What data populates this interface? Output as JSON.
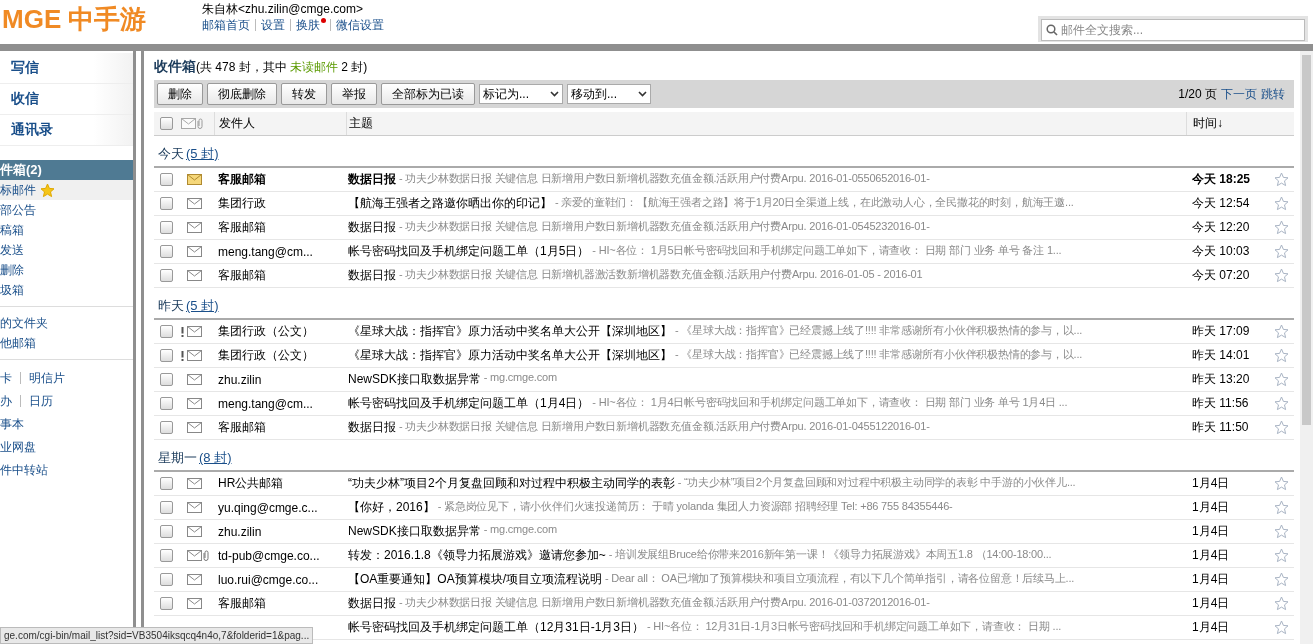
{
  "header": {
    "logo": "MGE 中手游",
    "user": "朱自林<zhu.zilin@cmge.com>",
    "links": [
      {
        "label": "邮箱首页"
      },
      {
        "label": "设置"
      },
      {
        "label": "换肤",
        "badge": true
      },
      {
        "label": "微信设置"
      }
    ],
    "search": {
      "placeholder": "邮件全文搜索..."
    }
  },
  "sidebar": {
    "actions": [
      {
        "label": "写信"
      },
      {
        "label": "收信"
      },
      {
        "label": "通讯录"
      }
    ],
    "folders": [
      {
        "label": "件箱(2)",
        "selected": true,
        "starred": false
      },
      {
        "label": "标邮件",
        "selected": false,
        "starred": true
      },
      {
        "label": "部公告",
        "selected": false,
        "starred": false
      },
      {
        "label": "稿箱",
        "selected": false,
        "starred": false
      },
      {
        "label": "发送",
        "selected": false,
        "starred": false
      },
      {
        "label": "删除",
        "selected": false,
        "starred": false
      },
      {
        "label": "圾箱",
        "selected": false,
        "starred": false
      }
    ],
    "my_folders": [
      {
        "label": "的文件夹"
      },
      {
        "label": "他邮箱"
      }
    ],
    "tools": [
      [
        "卡",
        "明信片"
      ],
      [
        "办",
        "日历"
      ],
      [
        "事本"
      ],
      [
        "业网盘"
      ],
      [
        "件中转站"
      ]
    ]
  },
  "mailbox": {
    "title": "收件箱",
    "summary_pre": "(共 478 封，其中 ",
    "unread_link": "未读邮件",
    "summary_post": " 2 封)",
    "select_all_checked": false,
    "buttons": [
      "删除",
      "彻底删除",
      "转发",
      "举报",
      "全部标为已读"
    ],
    "dropdowns": [
      "标记为...",
      "移动到..."
    ],
    "pager": {
      "page": "1/20 页",
      "next": "下一页",
      "jump": "跳转"
    },
    "columns": {
      "sender": "发件人",
      "subject": "主题",
      "time": "时间↓"
    },
    "groups": [
      {
        "label": "今天",
        "count": "(5 封)",
        "rows": [
          {
            "sender": "客服邮箱",
            "subject": "数据日报",
            "preview": "- 功夫少林数据日报 关键信息 日新增用户数日新增机器数充值金额.活跃用户付费Arpu. 2016-01-0550652016-01-",
            "time": "今天 18:25",
            "checked": false,
            "unread": true,
            "important": false,
            "attachment": false,
            "starred": false
          },
          {
            "sender": "集团行政",
            "subject": "【航海王强者之路邀你晒出你的印记】",
            "preview": "- 亲爱的童鞋们：【航海王强者之路】将于1月20日全渠道上线，在此激动人心，全民撒花的时刻，航海王邀...",
            "time": "今天 12:54",
            "checked": false,
            "unread": false,
            "important": false,
            "attachment": false,
            "starred": false
          },
          {
            "sender": "客服邮箱",
            "subject": "数据日报",
            "preview": "- 功夫少林数据日报 关键信息 日新增用户数日新增机器数充值金额.活跃用户付费Arpu. 2016-01-0545232016-01-",
            "time": "今天 12:20",
            "checked": false,
            "unread": false,
            "important": false,
            "attachment": false,
            "starred": false
          },
          {
            "sender": "meng.tang@cm...",
            "subject": "帐号密码找回及手机绑定问题工单（1月5日）",
            "preview": "- HI~各位： 1月5日帐号密码找回和手机绑定问题工单如下，请查收： 日期 部门 业务 单号 备注 1...",
            "time": "今天 10:03",
            "checked": false,
            "unread": false,
            "important": false,
            "attachment": false,
            "starred": false
          },
          {
            "sender": "客服邮箱",
            "subject": "数据日报",
            "preview": "- 功夫少林数据日报 关键信息 日新增机器激活数新增机器数充值金额.活跃用户付费Arpu. 2016-01-05 - 2016-01",
            "time": "今天 07:20",
            "checked": false,
            "unread": false,
            "important": false,
            "attachment": false,
            "starred": false
          }
        ]
      },
      {
        "label": "昨天",
        "count": "(5 封)",
        "rows": [
          {
            "sender": "集团行政（公文）",
            "subject": "《星球大战：指挥官》原力活动中奖名单大公开【深圳地区】",
            "preview": "- 《星球大战：指挥官》已经震撼上线了!!!! 非常感谢所有小伙伴积极热情的参与，以...",
            "time": "昨天 17:09",
            "checked": false,
            "unread": false,
            "important": true,
            "attachment": false,
            "starred": false
          },
          {
            "sender": "集团行政（公文）",
            "subject": "《星球大战：指挥官》原力活动中奖名单大公开【深圳地区】",
            "preview": "- 《星球大战：指挥官》已经震撼上线了!!!! 非常感谢所有小伙伴积极热情的参与，以...",
            "time": "昨天 14:01",
            "checked": false,
            "unread": false,
            "important": true,
            "attachment": false,
            "starred": false
          },
          {
            "sender": "zhu.zilin",
            "subject": "NewSDK接口取数据异常",
            "preview": "- mg.cmge.com",
            "time": "昨天 13:20",
            "checked": false,
            "unread": false,
            "important": false,
            "attachment": false,
            "starred": false
          },
          {
            "sender": "meng.tang@cm...",
            "subject": "帐号密码找回及手机绑定问题工单（1月4日）",
            "preview": "- HI~各位： 1月4日帐号密码找回和手机绑定问题工单如下，请查收： 日期 部门 业务 单号 1月4日 ...",
            "time": "昨天 11:56",
            "checked": false,
            "unread": false,
            "important": false,
            "attachment": false,
            "starred": false
          },
          {
            "sender": "客服邮箱",
            "subject": "数据日报",
            "preview": "- 功夫少林数据日报 关键信息 日新增用户数日新增机器数充值金额.活跃用户付费Arpu. 2016-01-0455122016-01-",
            "time": "昨天 11:50",
            "checked": false,
            "unread": false,
            "important": false,
            "attachment": false,
            "starred": false
          }
        ]
      },
      {
        "label": "星期一",
        "count": "(8 封)",
        "rows": [
          {
            "sender": "HR公共邮箱",
            "subject": "“功夫少林”项目2个月复盘回顾和对过程中积极主动同学的表彰",
            "preview": "- “功夫少林”项目2个月复盘回顾和对过程中积极主动同学的表彰 中手游的小伙伴儿...",
            "time": "1月4日",
            "checked": false,
            "unread": false,
            "important": false,
            "attachment": false,
            "starred": false
          },
          {
            "sender": "yu.qing@cmge.c...",
            "subject": "【你好，2016】",
            "preview": "- 紧急岗位见下，请小伙伴们火速投递简历： 于晴 yolanda 集团人力资源部 招聘经理 Tel: +86 755 84355446-",
            "time": "1月4日",
            "checked": false,
            "unread": false,
            "important": false,
            "attachment": false,
            "starred": false
          },
          {
            "sender": "zhu.zilin",
            "subject": "NewSDK接口取数据异常",
            "preview": "- mg.cmge.com",
            "time": "1月4日",
            "checked": false,
            "unread": false,
            "important": false,
            "attachment": false,
            "starred": false
          },
          {
            "sender": "td-pub@cmge.co...",
            "subject": "转发：2016.1.8《领导力拓展游戏》邀请您参加~",
            "preview": "- 培训发展组Bruce给你带来2016新年第一课！《领导力拓展游戏》本周五1.8 （14:00-18:00...",
            "time": "1月4日",
            "checked": false,
            "unread": false,
            "important": false,
            "attachment": true,
            "starred": false
          },
          {
            "sender": "luo.rui@cmge.co...",
            "subject": "【OA重要通知】OA预算模块/项目立项流程说明",
            "preview": "- Dear all： OA已增加了预算模块和项目立项流程，有以下几个简单指引，请各位留意！后续马上...",
            "time": "1月4日",
            "checked": false,
            "unread": false,
            "important": false,
            "attachment": false,
            "starred": false
          },
          {
            "sender": "客服邮箱",
            "subject": "数据日报",
            "preview": "- 功夫少林数据日报 关键信息 日新增用户数日新增机器数充值金额.活跃用户付费Arpu. 2016-01-0372012016-01-",
            "time": "1月4日",
            "checked": false,
            "unread": false,
            "important": false,
            "attachment": false,
            "starred": false
          },
          {
            "subject": "帐号密码找回及手机绑定问题工单（12月31日-1月3日）",
            "preview": "- HI~各位： 12月31日-1月3日帐号密码找回和手机绑定问题工单如下，请查收： 日期 ...",
            "time": "1月4日",
            "starred": false
          }
        ]
      }
    ]
  },
  "status_bar": "ge.com/cgi-bin/mail_list?sid=VB3504iksqcq4n4o,7&folderid=1&pag..."
}
